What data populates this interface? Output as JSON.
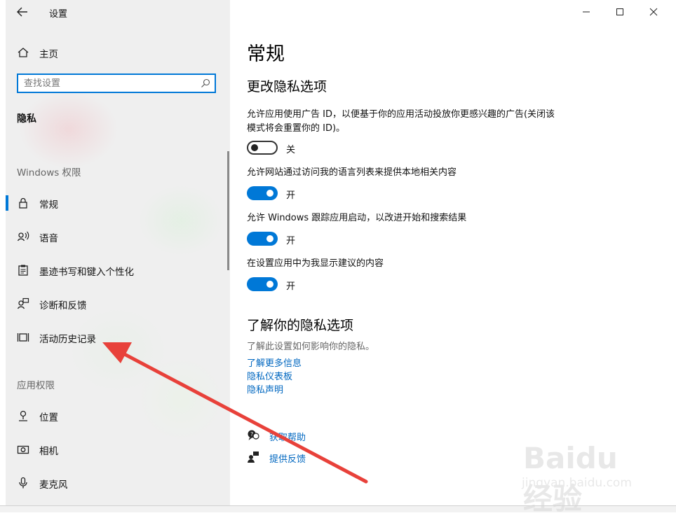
{
  "window": {
    "title": "设置",
    "controls": {
      "minimize": "minimize-icon",
      "maximize": "maximize-icon",
      "close": "close-icon"
    }
  },
  "sidebar": {
    "home_label": "主页",
    "search_placeholder": "查找设置",
    "section_title": "隐私",
    "windows_group_label": "Windows 权限",
    "windows_items": [
      {
        "label": "常规",
        "icon": "lock-icon",
        "active": true
      },
      {
        "label": "语音",
        "icon": "speech-icon",
        "active": false
      },
      {
        "label": "墨迹书写和键入个性化",
        "icon": "clipboard-icon",
        "active": false
      },
      {
        "label": "诊断和反馈",
        "icon": "feedback-person-icon",
        "active": false
      },
      {
        "label": "活动历史记录",
        "icon": "timeline-icon",
        "active": false
      }
    ],
    "app_group_label": "应用权限",
    "app_items": [
      {
        "label": "位置",
        "icon": "location-icon"
      },
      {
        "label": "相机",
        "icon": "camera-icon"
      },
      {
        "label": "麦克风",
        "icon": "microphone-icon"
      }
    ]
  },
  "main": {
    "page_title": "常规",
    "change_heading": "更改隐私选项",
    "options": [
      {
        "text": "允许应用使用广告 ID，以便基于你的应用活动投放你更感兴趣的广告(关闭该模式将会重置你的 ID)。",
        "state": "关",
        "on": false
      },
      {
        "text": "允许网站通过访问我的语言列表来提供本地相关内容",
        "state": "开",
        "on": true
      },
      {
        "text": "允许 Windows 跟踪应用启动，以改进开始和搜索结果",
        "state": "开",
        "on": true
      },
      {
        "text": "在设置应用中为我显示建议的内容",
        "state": "开",
        "on": true
      }
    ],
    "learn_heading": "了解你的隐私选项",
    "learn_desc": "了解此设置如何影响你的隐私。",
    "links": [
      "了解更多信息",
      "隐私仪表板",
      "隐私声明"
    ],
    "help": [
      {
        "label": "获取帮助",
        "icon": "help-chat-icon"
      },
      {
        "label": "提供反馈",
        "icon": "feedback-icon"
      }
    ]
  },
  "overlay": {
    "arrow_color": "#e8413a",
    "watermark_text": "Baidu经验",
    "watermark_sub": "jingyan.baidu.com"
  },
  "colors": {
    "accent": "#0078d7",
    "link": "#0067c0",
    "sidebar_bg": "#efefef"
  }
}
